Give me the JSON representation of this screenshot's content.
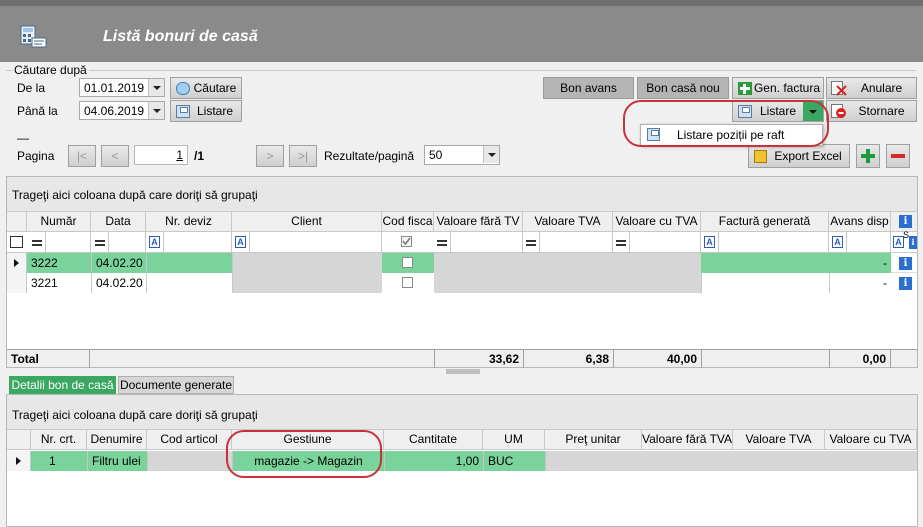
{
  "window": {
    "title": "Listă bonuri de casă"
  },
  "search": {
    "group_label": "Căutare după",
    "from_label": "De la",
    "from_value": "01.01.2019",
    "to_label": "Până la",
    "to_value": "04.06.2019",
    "search_button": "Căutare",
    "list_button": "Listare"
  },
  "toolbar": {
    "bon_avans": "Bon avans",
    "bon_casa_nou": "Bon casă nou",
    "gen_factura": "Gen. factura",
    "anulare": "Anulare",
    "listare": "Listare",
    "stornare": "Stornare",
    "dropdown_item": "Listare poziții pe raft"
  },
  "pager": {
    "pagina_label": "Pagina",
    "first": "|<",
    "prev": "<",
    "page": "1",
    "total": "/1",
    "next": ">",
    "last": ">|",
    "results_label": "Rezultate/pagină",
    "results_value": "50",
    "export": "Export Excel",
    "section_dash": "—"
  },
  "grid": {
    "group_hint": "Trageţi aici coloana după care doriţi să grupaţi",
    "columns": [
      "Număr",
      "Data",
      "Nr. deviz",
      "Client",
      "Cod fisca",
      "Valoare fără TV",
      "Valoare TVA",
      "Valoare cu TVA",
      "Factură generată",
      "Avans disp"
    ],
    "sort_indicator": "S",
    "rows": [
      {
        "numar": "3222",
        "data": "04.02.20",
        "avans": "-"
      },
      {
        "numar": "3221",
        "data": "04.02.20",
        "avans": "-"
      }
    ],
    "total_label": "Total",
    "totals": {
      "fara_tva": "33,62",
      "tva": "6,38",
      "cu_tva": "40,00",
      "avans": "0,00"
    }
  },
  "details": {
    "tabs": [
      "Detalii bon de casă",
      "Documente generate"
    ],
    "group_hint": "Trageţi aici coloana după care doriţi să grupaţi",
    "columns": [
      "Nr. crt.",
      "Denumire",
      "Cod articol",
      "Gestiune",
      "Cantitate",
      "UM",
      "Preţ unitar",
      "Valoare fără TVA",
      "Valoare TVA",
      "Valoare cu TVA"
    ],
    "rows": [
      {
        "nr": "1",
        "denumire": "Filtru ulei",
        "cod": "",
        "gestiune": "magazie -> Magazin",
        "cantitate": "1,00",
        "um": "BUC"
      }
    ]
  },
  "colors": {
    "title_bg": "#8a8a8a",
    "row_green": "#79d39b",
    "highlight_red": "#c8323a",
    "info_blue": "#2a6fd0"
  }
}
